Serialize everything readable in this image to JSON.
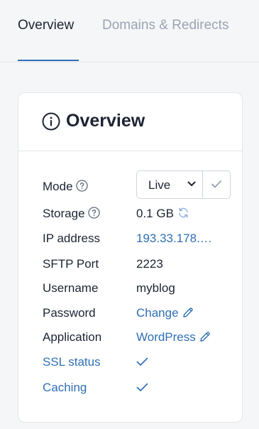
{
  "tabs": [
    {
      "label": "Overview"
    },
    {
      "label": "Domains & Redirects"
    }
  ],
  "card": {
    "title": "Overview",
    "title_icon": "info-circle-icon"
  },
  "rows": {
    "mode": {
      "label": "Mode",
      "selected": "Live"
    },
    "storage": {
      "label": "Storage",
      "value": "0.1 GB"
    },
    "ip": {
      "label": "IP address",
      "value": "193.33.178.…"
    },
    "sftp": {
      "label": "SFTP Port",
      "value": "2223"
    },
    "username": {
      "label": "Username",
      "value": "myblog"
    },
    "password": {
      "label": "Password",
      "value": "Change"
    },
    "application": {
      "label": "Application",
      "value": "WordPress"
    },
    "ssl": {
      "label": "SSL status"
    },
    "caching": {
      "label": "Caching"
    }
  },
  "colors": {
    "accent": "#2f6fb5",
    "text": "#1d2433",
    "muted": "#9aa4b2",
    "border": "#e3e6ea"
  }
}
